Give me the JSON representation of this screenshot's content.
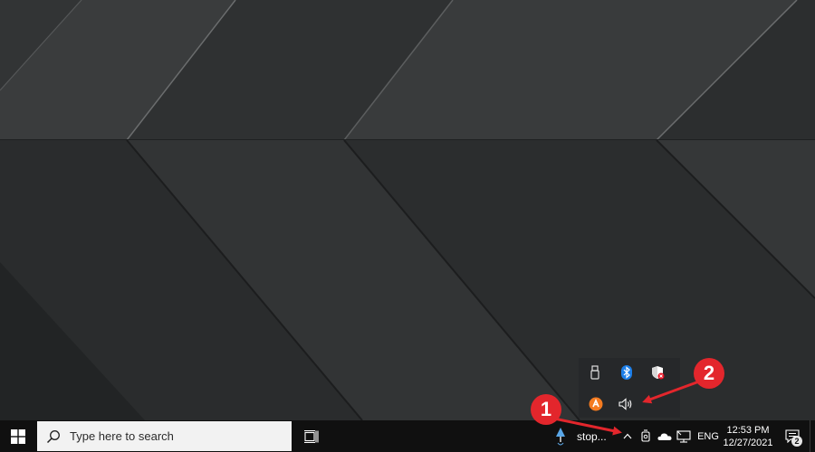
{
  "desktop": {
    "wallpaper": "dark-stone-chevron-wallpaper"
  },
  "tray_overflow": {
    "icons": [
      {
        "name": "usb-drive-icon"
      },
      {
        "name": "bluetooth-icon"
      },
      {
        "name": "windows-security-icon"
      },
      {
        "name": "avast-icon"
      },
      {
        "name": "speaker-icon"
      }
    ]
  },
  "taskbar": {
    "search_placeholder": "Type here to search",
    "running_app_label": "stop...",
    "language": "ENG",
    "time": "12:53 PM",
    "date": "12/27/2021",
    "notification_count": "2"
  },
  "annotations": {
    "callout_1": "1",
    "callout_2": "2",
    "color": "#e3262c"
  }
}
